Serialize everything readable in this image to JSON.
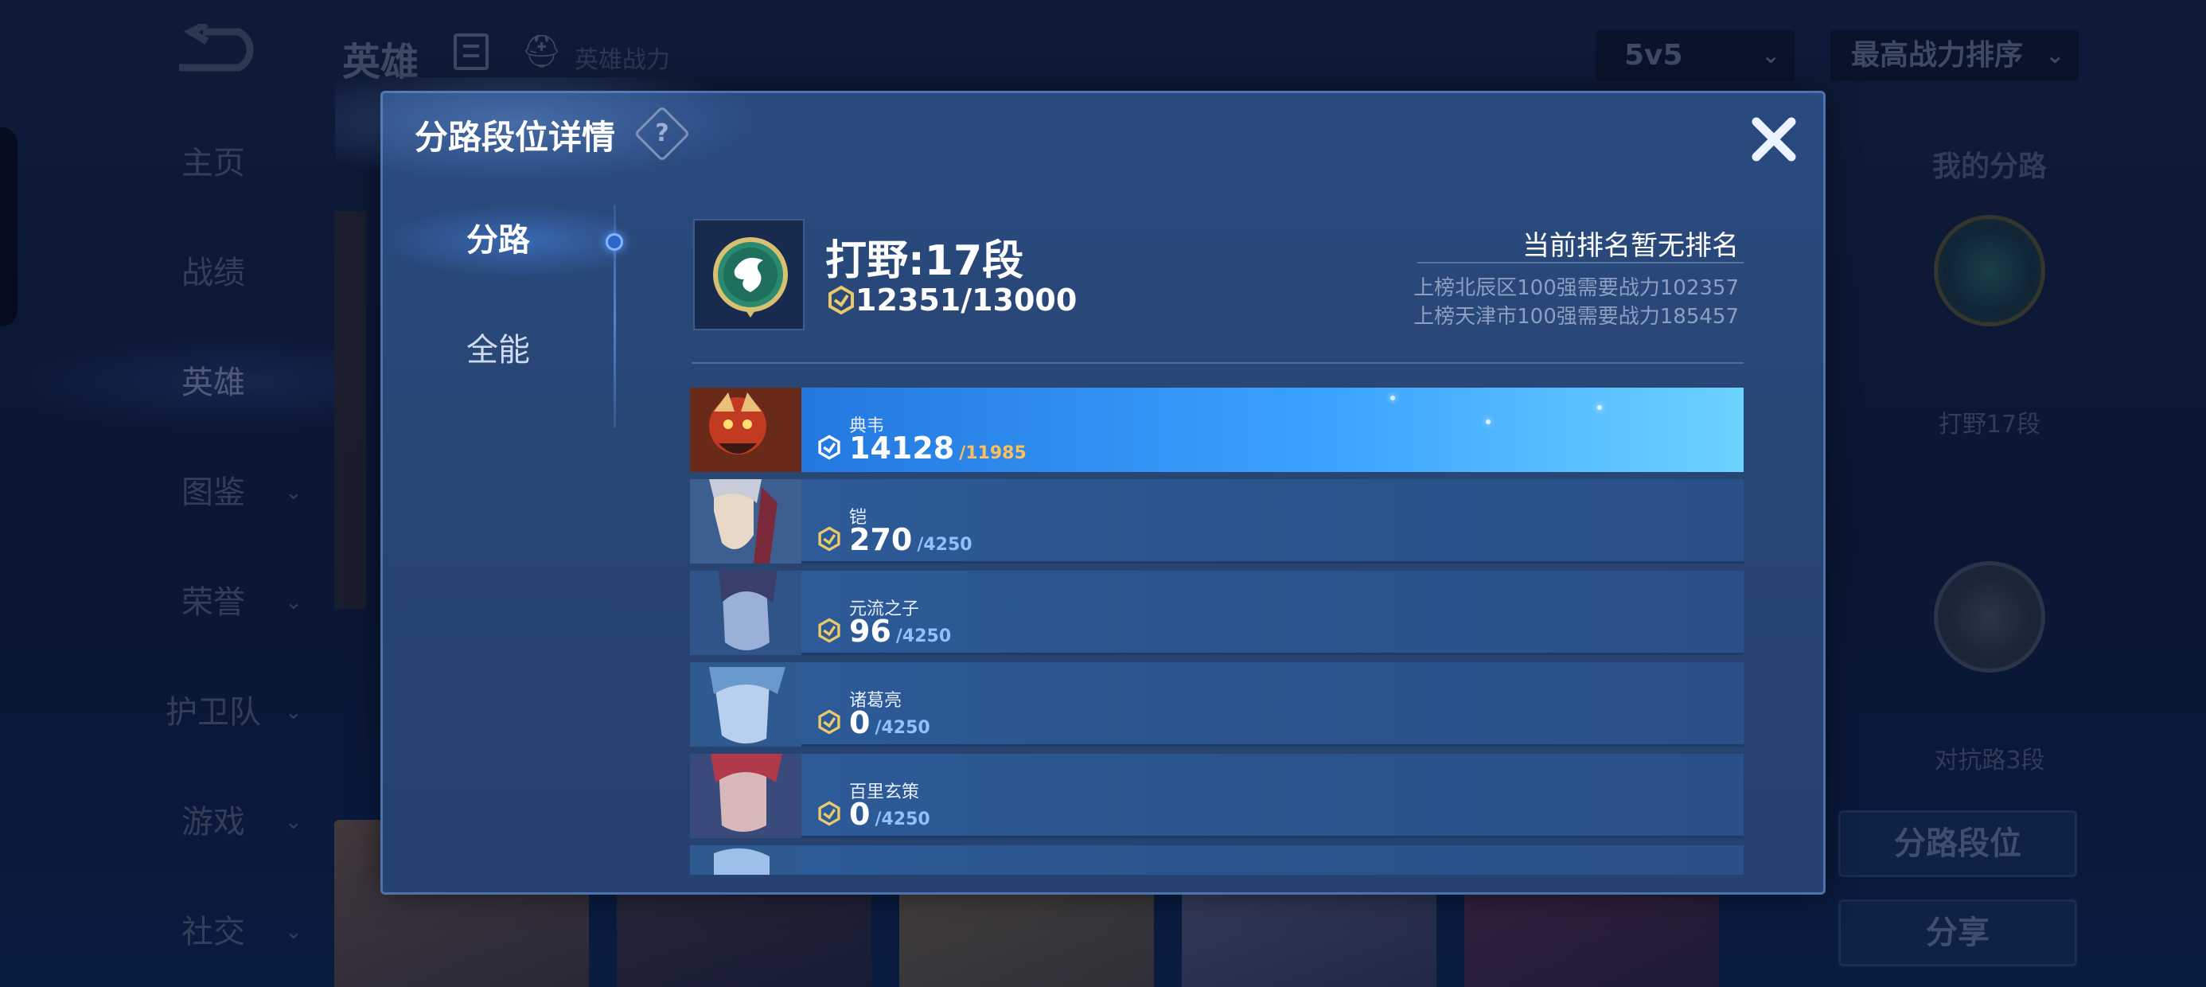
{
  "background": {
    "top_bar": {
      "title": "英雄",
      "power_label": "英雄战力",
      "mode_select": "5v5",
      "sort_select": "最高战力排序"
    },
    "nav": [
      {
        "label": "主页"
      },
      {
        "label": "战绩"
      },
      {
        "label": "英雄"
      },
      {
        "label": "图鉴"
      },
      {
        "label": "荣誉"
      },
      {
        "label": "护卫队"
      },
      {
        "label": "游戏"
      },
      {
        "label": "社交"
      }
    ],
    "right_panel": {
      "title": "我的分路",
      "lane_label": "打野17段",
      "lane2_label": "对抗路3段",
      "lane_rank_button": "分路段位",
      "share_button": "分享"
    }
  },
  "modal": {
    "title": "分路段位详情",
    "tabs": [
      {
        "label": "分路"
      },
      {
        "label": "全能"
      }
    ],
    "summary": {
      "title": "打野:17段",
      "score": "12351/13000",
      "rank_status": "当前排名暂无排名",
      "requirements": [
        "上榜北辰区100强需要战力102357",
        "上榜天津市100强需要战力185457"
      ]
    },
    "heroes": [
      {
        "name": "典韦",
        "score": "14128",
        "max": "/11985"
      },
      {
        "name": "铠",
        "score": "270",
        "max": "/4250"
      },
      {
        "name": "元流之子",
        "score": "96",
        "max": "/4250"
      },
      {
        "name": "诸葛亮",
        "score": "0",
        "max": "/4250"
      },
      {
        "name": "百里玄策",
        "score": "0",
        "max": "/4250"
      }
    ]
  },
  "colors": {
    "modal_bg": "#284672",
    "highlight_row": "#3aa2ff",
    "row_bg": "#2b568f",
    "max_highlight": "#ffbf5a",
    "max_normal": "#8fc0ff"
  }
}
